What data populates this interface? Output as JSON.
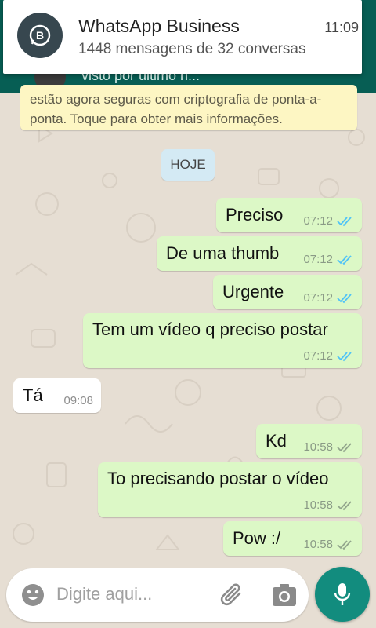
{
  "notification": {
    "app_name": "WhatsApp Business",
    "summary": "1448 mensagens de 32 conversas",
    "time": "11:09",
    "icon": "whatsapp-business-icon"
  },
  "header": {
    "status": "visto por último h..."
  },
  "encryption_banner": {
    "text": "estão agora seguras com criptografia de ponta-a-ponta. Toque para obter mais informações."
  },
  "date_chip": "HOJE",
  "messages": [
    {
      "text": "Preciso",
      "time": "07:12",
      "direction": "out",
      "status": "read"
    },
    {
      "text": "De uma thumb",
      "time": "07:12",
      "direction": "out",
      "status": "read"
    },
    {
      "text": "Urgente",
      "time": "07:12",
      "direction": "out",
      "status": "read"
    },
    {
      "text": "Tem um vídeo q preciso postar",
      "time": "07:12",
      "direction": "out",
      "status": "read"
    },
    {
      "text": "Tá",
      "time": "09:08",
      "direction": "in"
    },
    {
      "text": "Kd",
      "time": "10:58",
      "direction": "out",
      "status": "delivered"
    },
    {
      "text": "To precisando postar o vídeo",
      "time": "10:58",
      "direction": "out",
      "status": "delivered"
    },
    {
      "text": "Pow :/",
      "time": "10:58",
      "direction": "out",
      "status": "delivered"
    }
  ],
  "input": {
    "placeholder": "Digite aqui..."
  },
  "colors": {
    "outgoing_bubble": "#dcf8c6",
    "incoming_bubble": "#ffffff",
    "read_tick": "#4fc3f7",
    "delivered_tick": "#92a58c",
    "accent": "#128c7e"
  }
}
